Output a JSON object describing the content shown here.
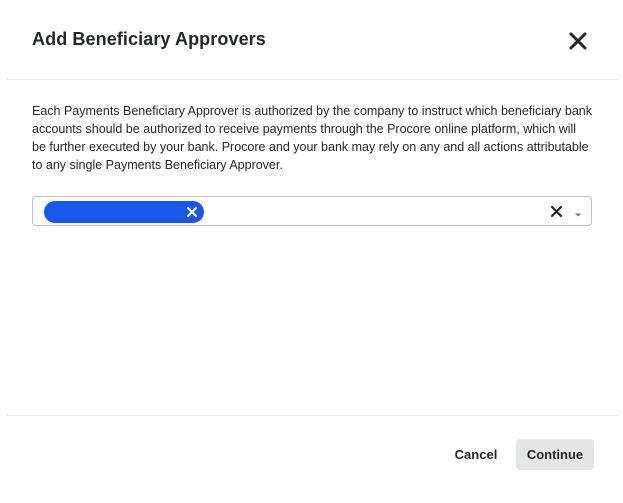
{
  "modal": {
    "title": "Add Beneficiary Approvers",
    "description": "Each Payments Beneficiary Approver is authorized by the company to instruct which beneficiary bank accounts should be authorized to receive payments through the Procore online platform, which will be further executed by your bank. Procore and your bank may rely on any and all actions attributable to any single Payments Beneficiary Approver.",
    "close_icon": "close-icon"
  },
  "approver_select": {
    "selected_tags": [
      {
        "label": ""
      }
    ],
    "clear_icon": "clear-icon",
    "dropdown_icon": "caret-down-icon"
  },
  "footer": {
    "cancel_label": "Cancel",
    "continue_label": "Continue"
  },
  "colors": {
    "tag_background": "#1a56e8",
    "continue_background": "#e3e6e8",
    "text": "#232729",
    "border": "#bcc2c6"
  }
}
